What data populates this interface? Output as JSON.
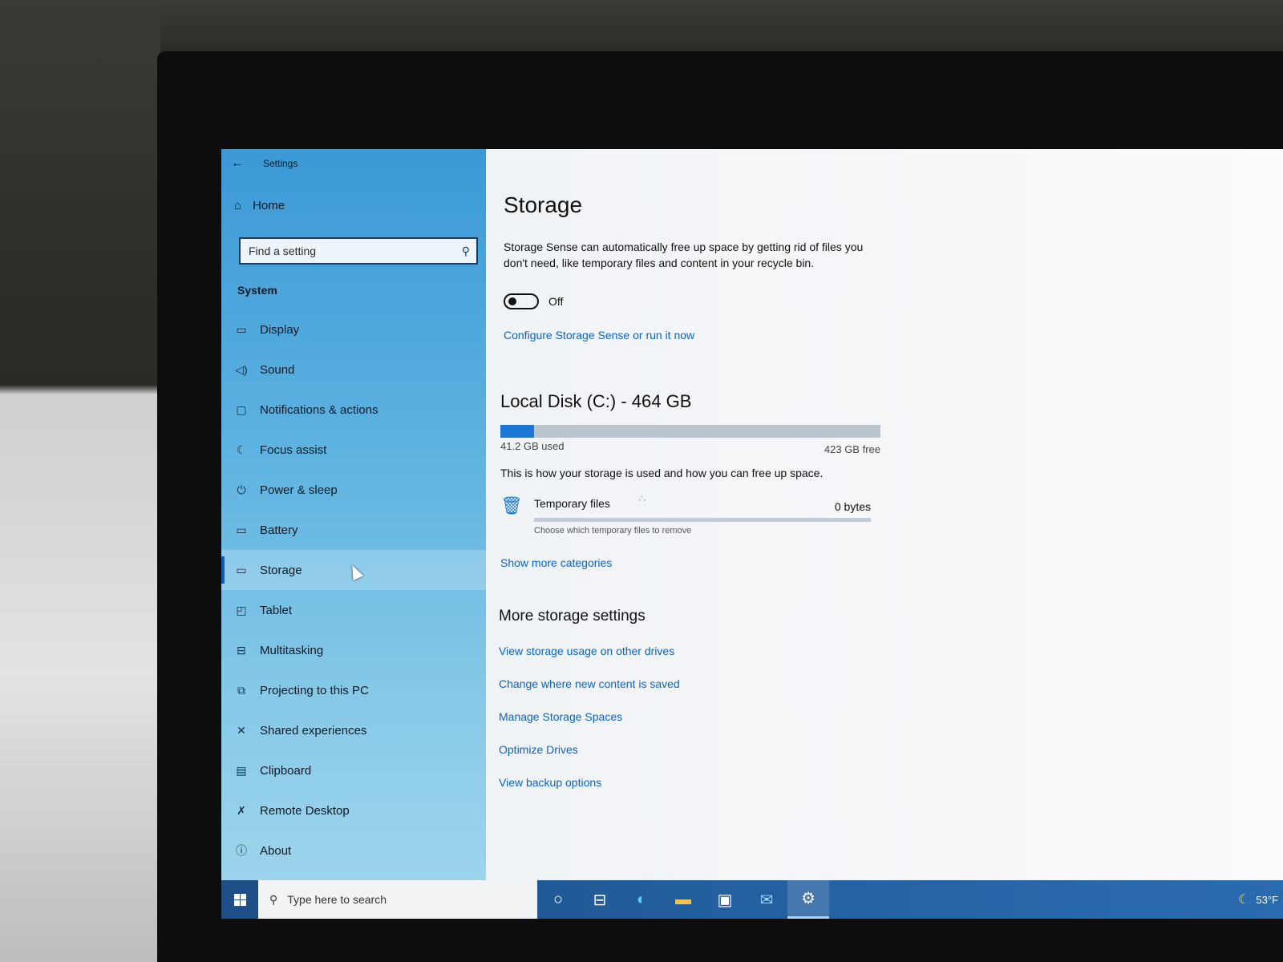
{
  "window": {
    "title": "Settings"
  },
  "sidebar": {
    "home_label": "Home",
    "search_placeholder": "Find a setting",
    "section": "System",
    "items": [
      {
        "label": "Display",
        "icon": "monitor-icon"
      },
      {
        "label": "Sound",
        "icon": "speaker-icon"
      },
      {
        "label": "Notifications & actions",
        "icon": "message-icon"
      },
      {
        "label": "Focus assist",
        "icon": "moon-icon"
      },
      {
        "label": "Power & sleep",
        "icon": "power-icon"
      },
      {
        "label": "Battery",
        "icon": "battery-icon"
      },
      {
        "label": "Storage",
        "icon": "drive-icon",
        "selected": true
      },
      {
        "label": "Tablet",
        "icon": "tablet-icon"
      },
      {
        "label": "Multitasking",
        "icon": "multitasking-icon"
      },
      {
        "label": "Projecting to this PC",
        "icon": "projecting-icon"
      },
      {
        "label": "Shared experiences",
        "icon": "shared-icon"
      },
      {
        "label": "Clipboard",
        "icon": "clipboard-icon"
      },
      {
        "label": "Remote Desktop",
        "icon": "remote-desktop-icon"
      },
      {
        "label": "About",
        "icon": "info-icon"
      }
    ]
  },
  "main": {
    "title": "Storage",
    "storage_sense_desc": "Storage Sense can automatically free up space by getting rid of files you don't need, like temporary files and content in your recycle bin.",
    "toggle_state": "Off",
    "configure_link": "Configure Storage Sense or run it now",
    "disk": {
      "title": "Local Disk (C:) - 464 GB",
      "used_label": "41.2 GB used",
      "free_label": "423 GB free",
      "used_fraction": 0.089
    },
    "howto": "This is how your storage is used and how you can free up space.",
    "temp_files": {
      "title": "Temporary files",
      "size": "0 bytes",
      "subtitle": "Choose which temporary files to remove"
    },
    "show_more": "Show more categories",
    "more_title": "More storage settings",
    "more_links": [
      "View storage usage on other drives",
      "Change where new content is saved",
      "Manage Storage Spaces",
      "Optimize Drives",
      "View backup options"
    ]
  },
  "taskbar": {
    "search_placeholder": "Type here to search",
    "temperature": "53°F"
  },
  "colors": {
    "accent": "#1a77d4",
    "link": "#0b63c4",
    "taskbar": "#2460a0"
  }
}
